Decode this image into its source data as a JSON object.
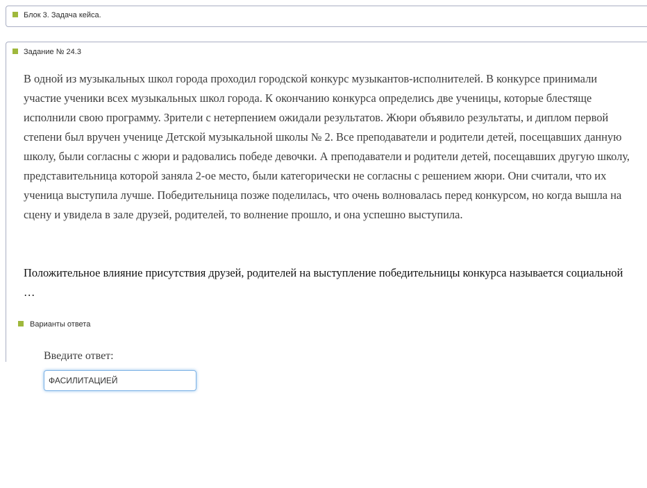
{
  "block": {
    "title": "Блок 3. Задача кейса."
  },
  "task": {
    "title": "Задание № 24.3",
    "case_text": "В одной из музыкальных школ города проходил городской конкурс музыкантов-исполнителей. В конкурсе принимали участие ученики всех музыкальных школ города. К окончанию конкурса определись две ученицы, которые блестяще исполнили свою программу. Зрители с нетерпением ожидали результатов. Жюри объявило результаты, и диплом первой степени был вручен ученице Детской музыкальной школы № 2. Все преподаватели и родители детей, посещавших данную школу, были согласны с жюри и радовались победе девочки. А преподаватели и родители детей, посещавших другую школу, представительница которой заняла 2-ое место, были категорически не согласны с решением жюри. Они считали, что их ученица выступила лучше. Победительница позже поделилась, что очень волновалась перед конкурсом, но когда вышла на сцену и увидела в зале друзей, родителей, то волнение прошло, и она успешно выступила.",
    "question": "Положительное влияние присутствия друзей, родителей на выступление победительницы конкурса называется социальной …"
  },
  "answers": {
    "section_title": "Варианты ответа",
    "prompt": "Введите ответ:",
    "input_value": "ФАСИЛИТАЦИЕЙ"
  },
  "colors": {
    "accent_square": "#9fb83c",
    "panel_border": "#a9aec3",
    "input_focus": "#7fb3e6"
  }
}
